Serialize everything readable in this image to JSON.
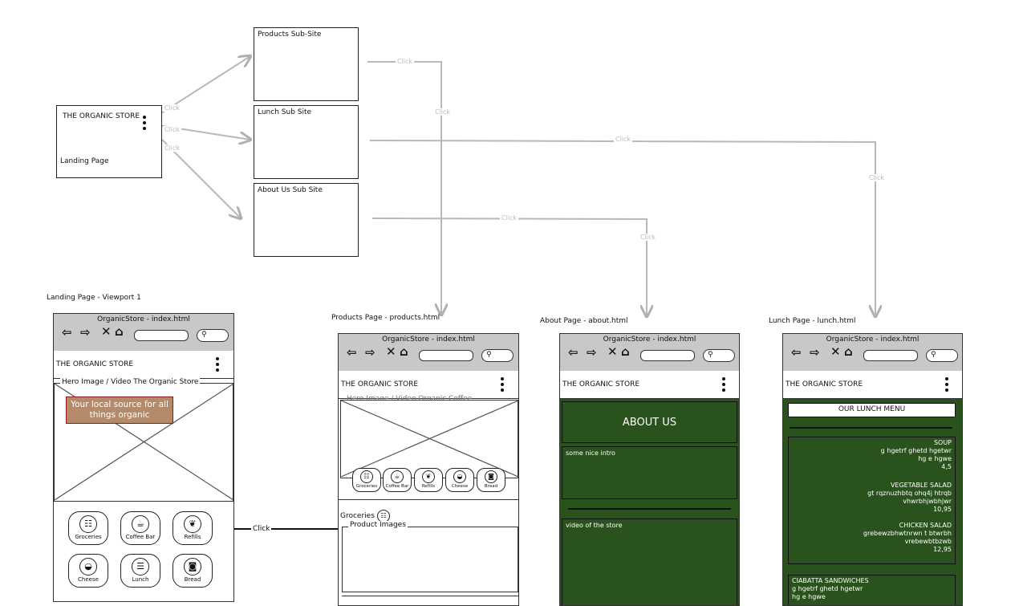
{
  "flow": {
    "landing_box": {
      "title": "THE ORGANIC STORE",
      "subtitle": "Landing Page"
    },
    "products_box": {
      "title": "Products Sub-Site"
    },
    "lunch_box": {
      "title": "Lunch Sub Site"
    },
    "about_box": {
      "title": "About Us Sub Site"
    },
    "click_label": "Click"
  },
  "screens": {
    "landing": {
      "caption": "Landing Page - Viewport 1",
      "browser_title": "OrganicStore - index.html",
      "app_title": "THE ORGANIC STORE",
      "hero_label": "Hero Image / Video The Organic Store",
      "hero_text": "Your local source for all things organic",
      "categories": [
        "Groceries",
        "Coffee Bar",
        "Refills",
        "Cheese",
        "Lunch",
        "Bread"
      ],
      "connector_label": "Click"
    },
    "products": {
      "caption": "Products Page - products.html",
      "browser_title": "OrganicStore - index.html",
      "app_title": "THE ORGANIC STORE",
      "hero_label": "Hero Image / Video Organic Coffee",
      "categories": [
        "Groceries",
        "Coffee Bar",
        "Refills",
        "Cheese",
        "Bread"
      ],
      "section_title": "Groceries",
      "product_images_label": "Product Images"
    },
    "about": {
      "caption": "About Page - about.html",
      "browser_title": "OrganicStore - index.html",
      "app_title": "THE ORGANIC STORE",
      "heading": "ABOUT US",
      "intro": "some nice intro",
      "video": "video of the store"
    },
    "lunch": {
      "caption": "Lunch Page - lunch.html",
      "browser_title": "OrganicStore - index.html",
      "app_title": "THE ORGANIC STORE",
      "heading": "OUR LUNCH MENU",
      "menu": [
        {
          "name": "SOUP",
          "desc": "g hgetrf ghetd hgetwr",
          "desc2": "hg e hgwe",
          "price": "4,5"
        },
        {
          "name": "VEGETABLE SALAD",
          "desc": "gt rqznuzhbtq ohq4j htrqb",
          "desc2": "vhwrbhjwbhjwr",
          "price": "10,95"
        },
        {
          "name": "CHICKEN SALAD",
          "desc": "grebewzbhwtnrwn t btwrbh",
          "desc2": "vrebewbtbzwb",
          "price": "12,95"
        }
      ],
      "sandwiches": {
        "name": "CIABATTA SANDWICHES",
        "desc": "g hgetrf ghetd hgetwr",
        "desc2": "hg e hgwe"
      }
    }
  },
  "colors": {
    "green": "#2a521c",
    "hero_text_bg": "#b48a6a",
    "hero_text_border": "#8b1a1a",
    "connector": "#b8b8b8"
  }
}
